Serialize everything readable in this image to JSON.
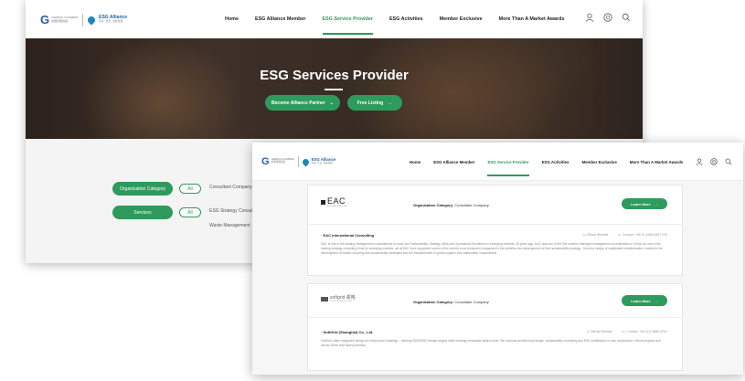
{
  "nav": {
    "logo_partner_line1": "GERMAN CHAMBER",
    "logo_partner_line2": "中国德国商会",
    "logo_brand": "ESG Alliance",
    "logo_brand_sub": "环境 · 社会 · 治理 联盟",
    "items": [
      "Home",
      "ESG Alliance Member",
      "ESG Service Provider",
      "ESG Activities",
      "Member Exclusive",
      "More Than A Market Awards"
    ],
    "active_index": 2,
    "icons": [
      "user-icon",
      "language-icon",
      "search-icon"
    ]
  },
  "hero": {
    "title": "ESG Services Provider",
    "btn_partner": "Become Alliance Partner",
    "btn_listing": "Free Listing"
  },
  "filters": {
    "category_label": "Organization Category",
    "category_all": "All",
    "category_first_option": "Consultant Company",
    "services_label": "Services",
    "services_all": "All",
    "services_first_option": "ESG Strategy Consult",
    "services_second_option": "Waste Management"
  },
  "cards": [
    {
      "logo_text": "EAC",
      "logo_sub": "EURO ASIA CONSULTING",
      "category_label": "Organization Category:",
      "category_value": "Consultant Company",
      "button": "Learn More",
      "name": "EAC International Consulting",
      "website": "Official Website",
      "contact": "Contact: +86 21 6358 8387 029",
      "description": "EAC is one of the leading management consultancies for Asia and Sustainability, Strategy, M&A and Operational Excellence in emerging markets. 30 years ago, EAC was one of the first western managed management consultancies in China. As one of the leading strategy consulting firms for emerging markets, we at EAC have supported scores of the world's most renowned companies in the definition and development of their sustainability strategy - from the design of sustainable transformation models to the development of holistic recycling and sustainability strategies and the establishment of global supplier and stakeholder cooperations."
    },
    {
      "logo_text": "softgrid 柔格",
      "logo_sub": "SOFTGRID ARCHITECTURE",
      "category_label": "Organization Category:",
      "category_value": "Consultant Company",
      "button": "Learn More",
      "name": "SoftGrid (Shanghai) Co., Ltd.",
      "website": "Official Website",
      "contact": "Contact: +86 (21) 5865 8781",
      "description": "SoftGrid offers integrated design for future-proof buildings – meeting 2030/2050 climate targets while creating immediate added value. We combine architectural design, sustainability consulting and ESG certification in new construction, retrofit projects and across entire built asset portfolios."
    }
  ],
  "colors": {
    "accent_green": "#2e9a5c",
    "brand_blue": "#1e5fa8"
  }
}
